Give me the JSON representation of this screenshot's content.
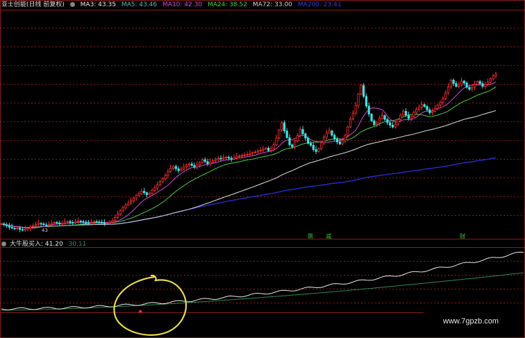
{
  "main_legend": {
    "title": "亚士创能(日线 前复权)",
    "ma": [
      {
        "label": "MA3: 43.35",
        "color": "#e8e8e8"
      },
      {
        "label": "MA5: 43.46",
        "color": "#4bb8b8"
      },
      {
        "label": "MA10: 42.30",
        "color": "#e040e0"
      },
      {
        "label": "MA24: 38.52",
        "color": "#40d040"
      },
      {
        "label": "MA72: 33.00",
        "color": "#cfcfcf"
      },
      {
        "label": "MA200: 23.41",
        "color": "#3b3bd8"
      }
    ]
  },
  "sub_legend": {
    "title": "大牛股买入",
    "value1": ": 41.20",
    "value2": "30.11",
    "value1_color": "#e8e8e8",
    "value2_color": "#2e8b57"
  },
  "markers": [
    "跳",
    "减",
    "财"
  ],
  "low_label": "43",
  "watermark": "www.7gpzb.com",
  "colors": {
    "grid": "#8b1a1a",
    "up": "#ff3030",
    "down": "#40e0e0",
    "circle": "#e8d84a"
  },
  "chart_data": [
    {
      "type": "candlestick",
      "title": "亚士创能(日线 前复权)",
      "series": [
        {
          "name": "MA3",
          "last": 43.35
        },
        {
          "name": "MA5",
          "last": 43.46
        },
        {
          "name": "MA10",
          "last": 42.3
        },
        {
          "name": "MA24",
          "last": 38.52
        },
        {
          "name": "MA72",
          "last": 33.0
        },
        {
          "name": "MA200",
          "last": 23.41
        }
      ],
      "price_scale": [
        15,
        46
      ],
      "grid": true,
      "close": [
        15.5,
        15.3,
        15.1,
        14.8,
        14.6,
        14.5,
        14.6,
        14.3,
        14.2,
        14.4,
        14.6,
        14.9,
        15.1,
        15.4,
        15.6,
        15.5,
        15.3,
        15.2,
        15.4,
        15.6,
        15.8,
        15.7,
        15.5,
        15.6,
        15.9,
        16.0,
        15.8,
        15.7,
        15.9,
        16.1,
        16.0,
        15.8,
        15.7,
        15.6,
        15.8,
        16.0,
        15.9,
        15.8,
        15.7,
        15.6,
        15.7,
        15.9,
        16.2,
        16.8,
        17.5,
        18.3,
        18.9,
        19.4,
        19.8,
        20.3,
        20.9,
        21.4,
        21.8,
        22.3,
        22.0,
        21.6,
        21.9,
        22.5,
        23.0,
        23.6,
        24.3,
        24.9,
        25.6,
        26.4,
        27.1,
        27.5,
        27.0,
        26.6,
        26.9,
        27.4,
        27.8,
        28.0,
        27.7,
        27.3,
        27.8,
        28.3,
        28.9,
        28.5,
        28.0,
        28.4,
        28.7,
        29.0,
        29.2,
        29.1,
        29.3,
        29.4,
        29.2,
        29.0,
        29.3,
        29.6,
        29.7,
        29.8,
        29.9,
        30.0,
        30.2,
        30.4,
        30.5,
        30.7,
        30.9,
        31.1,
        31.3,
        30.8,
        31.2,
        32.0,
        33.4,
        35.1,
        36.6,
        34.9,
        33.5,
        32.0,
        31.6,
        32.8,
        33.9,
        35.2,
        34.3,
        33.4,
        32.3,
        31.9,
        31.0,
        30.6,
        31.2,
        32.4,
        33.6,
        34.5,
        34.9,
        34.0,
        33.2,
        32.6,
        32.2,
        32.8,
        34.0,
        35.7,
        37.4,
        38.6,
        40.2,
        42.6,
        44.4,
        42.1,
        40.1,
        38.4,
        37.0,
        36.2,
        36.5,
        37.5,
        38.1,
        37.3,
        36.6,
        36.1,
        35.7,
        36.3,
        37.3,
        38.2,
        39.0,
        38.2,
        37.5,
        37.9,
        38.8,
        39.4,
        39.8,
        40.4,
        40.0,
        39.3,
        38.7,
        39.0,
        39.6,
        40.3,
        40.9,
        41.6,
        42.8,
        44.1,
        45.5,
        44.8,
        44.2,
        44.5,
        45.3,
        44.9,
        44.0,
        43.6,
        44.0,
        44.6,
        45.2,
        44.8,
        44.2,
        44.6,
        45.1,
        45.8,
        46.4,
        46.8
      ]
    },
    {
      "type": "line",
      "title": "大牛股买入",
      "series": [
        {
          "name": "大牛股买入",
          "last": 41.2
        },
        {
          "name": "",
          "last": 30.11
        }
      ]
    }
  ]
}
